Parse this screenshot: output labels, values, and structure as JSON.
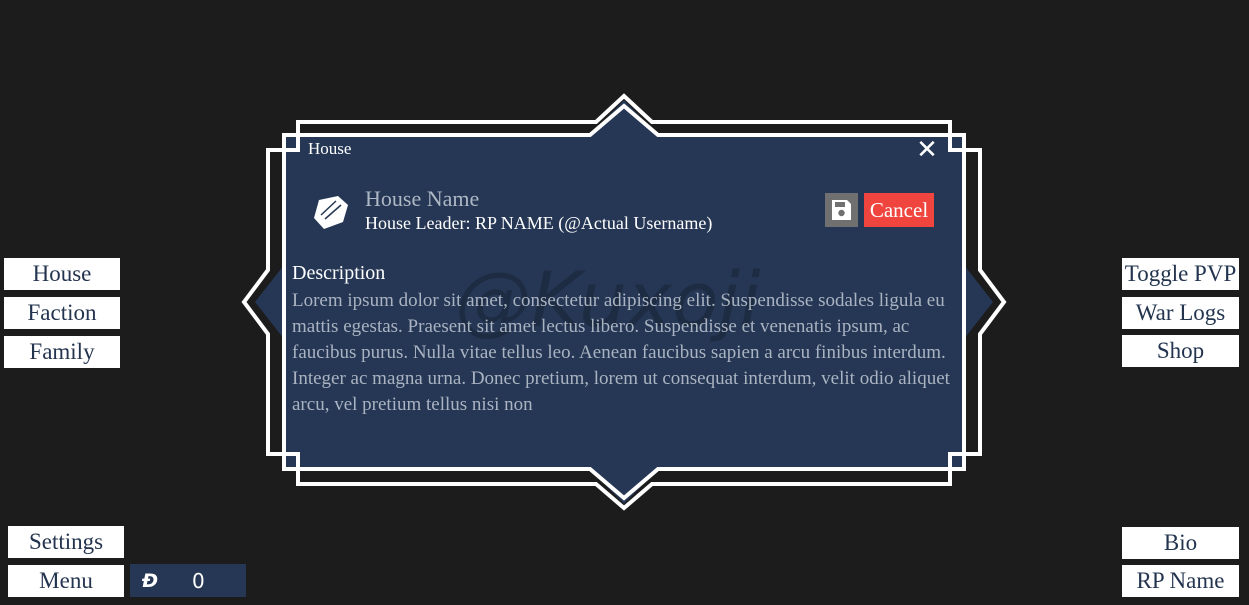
{
  "left_menu": {
    "house": "House",
    "faction": "Faction",
    "family": "Family",
    "settings": "Settings",
    "menu": "Menu"
  },
  "right_menu": {
    "toggle_pvp": "Toggle PVP",
    "war_logs": "War Logs",
    "shop": "Shop",
    "bio": "Bio",
    "rp_name": "RP Name"
  },
  "currency": {
    "symbol": "Đ",
    "amount": "0"
  },
  "modal": {
    "title": "House",
    "close": "✕",
    "house_name": "House Name",
    "house_leader": "House Leader: RP NAME (@Actual Username)",
    "cancel_label": "Cancel",
    "description_title": "Description",
    "description": "Lorem ipsum dolor sit amet, consectetur adipiscing elit. Suspendisse sodales ligula eu mattis egestas. Praesent sit amet lectus libero. Suspendisse et venenatis ipsum, ac faucibus purus. Nulla vitae tellus leo. Aenean faucibus sapien a arcu finibus interdum. Integer ac magna urna. Donec pretium, lorem ut consequat interdum, velit odio aliquet arcu, vel pretium tellus nisi non",
    "watermark": "@Kuxoji"
  },
  "colors": {
    "background": "#1c1c1c",
    "panel": "#253754",
    "cancel": "#f0453e",
    "button_text": "#23344f"
  },
  "icons": {
    "shield": "shield-icon",
    "save": "floppy-disk-icon",
    "close": "close-icon",
    "currency": "dogecoin-icon"
  }
}
